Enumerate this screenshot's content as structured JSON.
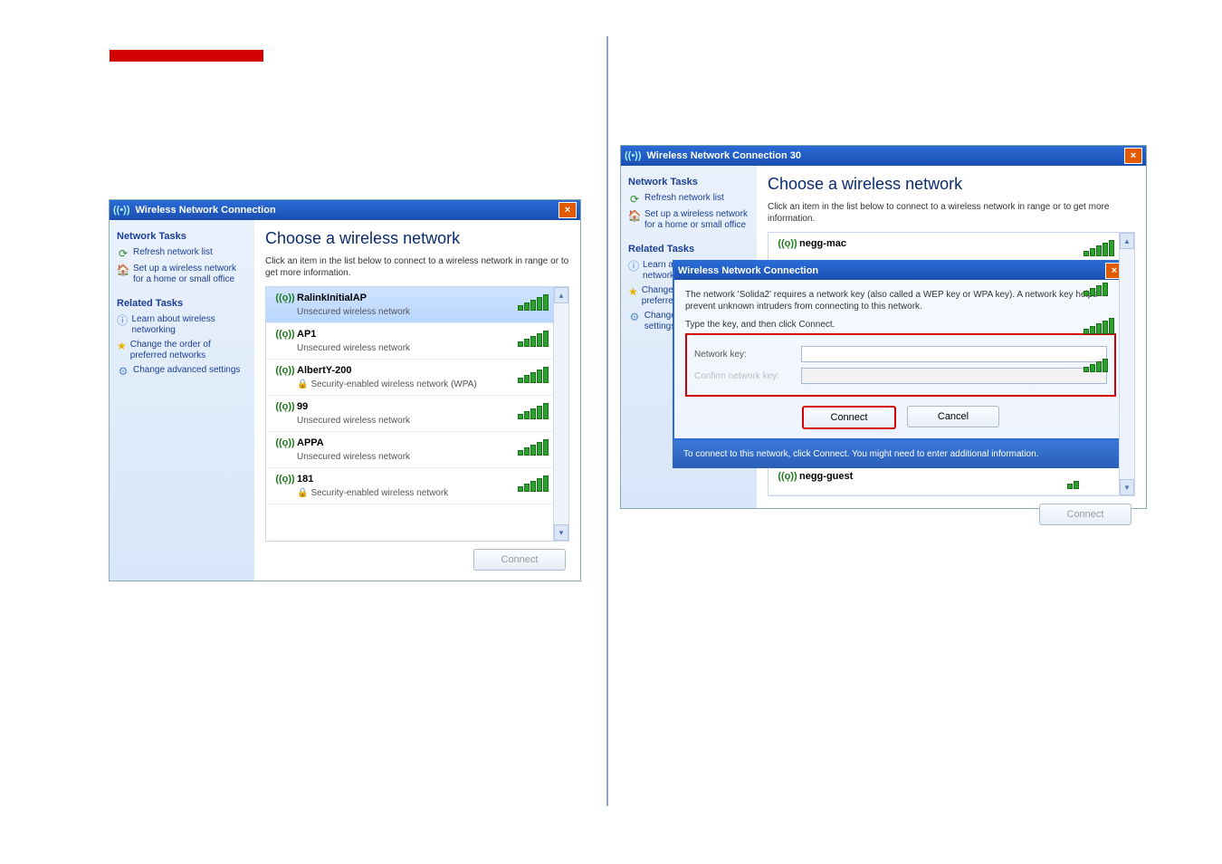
{
  "shot1": {
    "title": "Wireless Network Connection",
    "sidebar": {
      "h1": "Network Tasks",
      "links1": [
        "Refresh network list",
        "Set up a wireless network for a home or small office"
      ],
      "h2": "Related Tasks",
      "links2": [
        "Learn about wireless networking",
        "Change the order of preferred networks",
        "Change advanced settings"
      ]
    },
    "heading": "Choose a wireless network",
    "subtext": "Click an item in the list below to connect to a wireless network in range or to get more information.",
    "networks": [
      {
        "name": "RalinkInitialAP",
        "sec": "Unsecured wireless network",
        "locked": false
      },
      {
        "name": "AP1",
        "sec": "Unsecured wireless network",
        "locked": false
      },
      {
        "name": "AlbertY-200",
        "sec": "Security-enabled wireless network (WPA)",
        "locked": true
      },
      {
        "name": "99",
        "sec": "Unsecured wireless network",
        "locked": false
      },
      {
        "name": "APPA",
        "sec": "Unsecured wireless network",
        "locked": false
      },
      {
        "name": "181",
        "sec": "Security-enabled wireless network",
        "locked": true
      }
    ],
    "connect": "Connect"
  },
  "shot2": {
    "title": "Wireless Network Connection 30",
    "sidebar": {
      "h1": "Network Tasks",
      "links1": [
        "Refresh network list",
        "Set up a wireless network for a home or small office"
      ],
      "h2": "Related Tasks",
      "links2": [
        "Learn about wireless networking",
        "Change the order of preferred networks",
        "Change advanced settings"
      ]
    },
    "heading": "Choose a wireless network",
    "subtext": "Click an item in the list below to connect to a wireless network in range or to get more information.",
    "topnet": "negg-mac",
    "dialog": {
      "title": "Wireless Network Connection",
      "msg": "The network 'Solida2' requires a network key (also called a WEP key or WPA key). A network key helps prevent unknown intruders from connecting to this network.",
      "msg2": "Type the key, and then click Connect.",
      "lab1": "Network key:",
      "lab2": "Confirm network key:",
      "connect": "Connect",
      "cancel": "Cancel"
    },
    "hint": "To connect to this network, click Connect. You might need to enter additional information.",
    "botnet": "negg-guest",
    "connect": "Connect"
  }
}
